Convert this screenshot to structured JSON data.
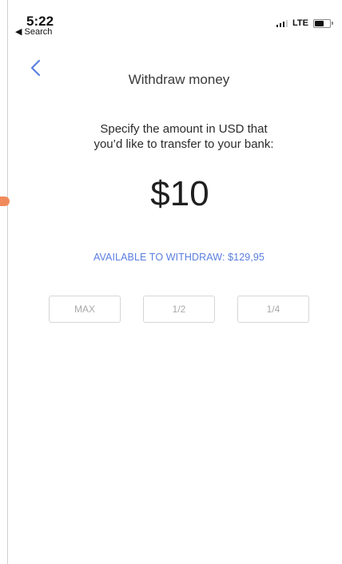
{
  "status_bar": {
    "time": "5:22",
    "back_label": "◀ Search",
    "network": "LTE",
    "icons": [
      "signal-icon",
      "battery-icon"
    ]
  },
  "header": {
    "back_icon": "chevron-left-icon",
    "title": "Withdraw money"
  },
  "main": {
    "instructions": [
      "Specify the amount in USD that",
      "you’d like to transfer to your bank:"
    ],
    "amount": "$10",
    "available_label": "AVAILABLE TO WITHDRAW: $129,95",
    "quick_buttons": [
      {
        "label": "MAX"
      },
      {
        "label": "1/2"
      },
      {
        "label": "1/4"
      }
    ]
  },
  "colors": {
    "accent": "#5B7FE0",
    "marker": "#F08A5D",
    "text": "#2B2B2B",
    "muted": "#A9A9A9"
  }
}
